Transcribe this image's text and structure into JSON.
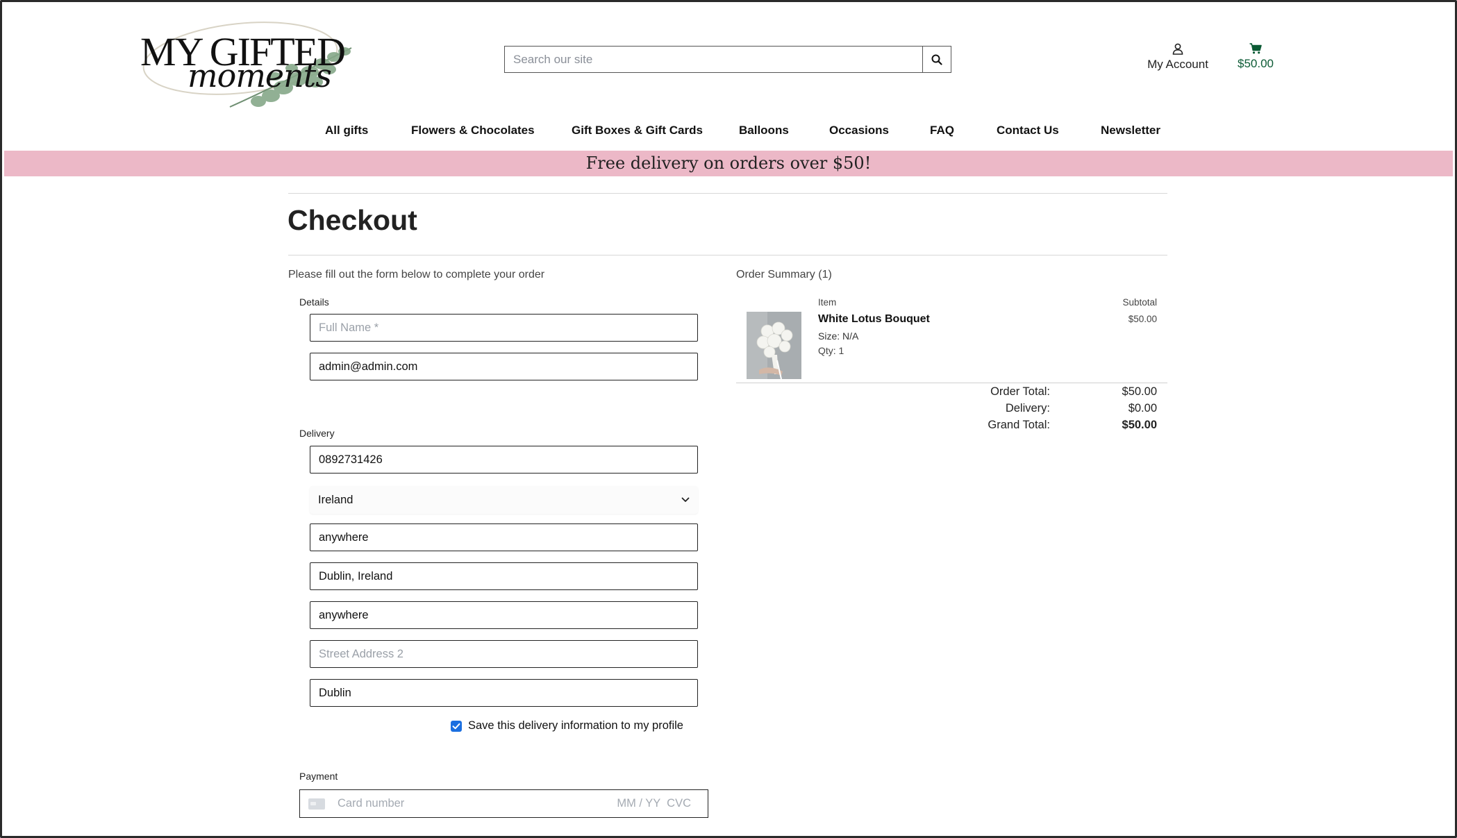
{
  "brand": {
    "logo_main": "MY GIFTED",
    "logo_script": "moments"
  },
  "search": {
    "placeholder": "Search our site"
  },
  "header": {
    "account_label": "My Account",
    "cart_total": "$50.00"
  },
  "nav": {
    "items": [
      "All gifts",
      "Flowers & Chocolates",
      "Gift Boxes & Gift Cards",
      "Balloons",
      "Occasions",
      "FAQ",
      "Contact Us",
      "Newsletter"
    ]
  },
  "banner": {
    "text": "Free delivery on orders over $50!"
  },
  "checkout": {
    "title": "Checkout",
    "lead": "Please fill out the form below to complete your order",
    "details": {
      "label": "Details",
      "full_name_placeholder": "Full Name *",
      "full_name_value": "",
      "email_value": "admin@admin.com"
    },
    "delivery": {
      "label": "Delivery",
      "phone_value": "0892731426",
      "country_value": "Ireland",
      "field_3_value": "anywhere",
      "field_4_value": "Dublin, Ireland",
      "street_address_1_value": "anywhere",
      "street_address_2_placeholder": "Street Address 2",
      "county_value": "Dublin",
      "save_info_label": "Save this delivery information to my profile",
      "save_info_checked": true
    },
    "payment": {
      "label": "Payment",
      "card_number_placeholder": "Card number",
      "expiry_cvc_placeholder": "MM / YY  CVC"
    }
  },
  "summary": {
    "heading": "Order Summary (1)",
    "col_item": "Item",
    "col_subtotal": "Subtotal",
    "items": [
      {
        "name": "White Lotus Bouquet",
        "size": "Size: N/A",
        "qty": "Qty: 1",
        "subtotal": "$50.00"
      }
    ],
    "order_total_label": "Order Total:",
    "order_total_value": "$50.00",
    "delivery_label": "Delivery:",
    "delivery_value": "$0.00",
    "grand_total_label": "Grand Total:",
    "grand_total_value": "$50.00"
  },
  "colors": {
    "banner_bg": "#ecb8c7",
    "cart_green": "#0b5a34",
    "checkbox_blue": "#1b6fe0"
  }
}
